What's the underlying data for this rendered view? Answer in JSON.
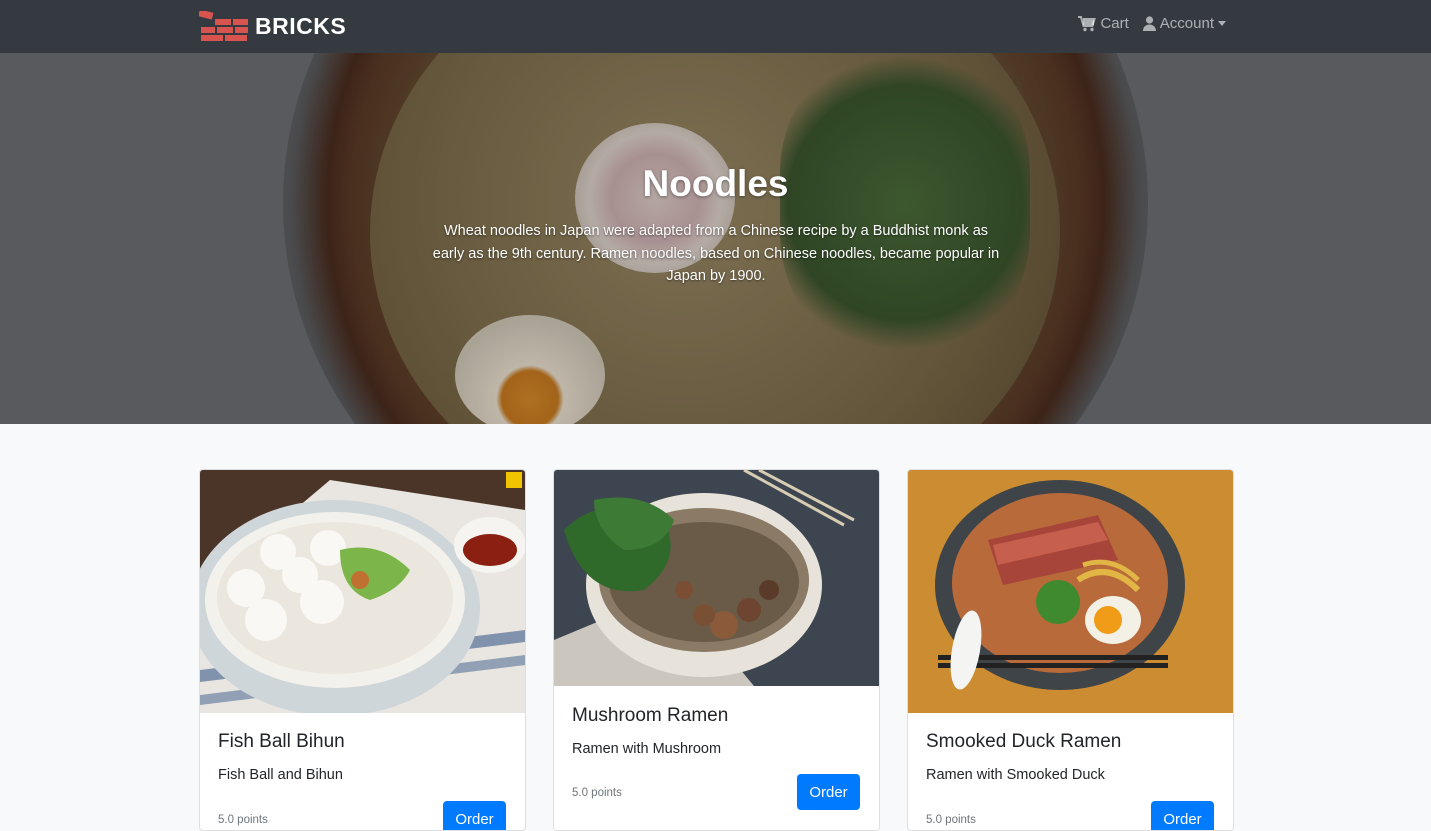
{
  "brand": {
    "name": "BRICKS",
    "logo_color": "#d9534f"
  },
  "nav": {
    "cart_label": "Cart",
    "account_label": "Account"
  },
  "hero": {
    "title": "Noodles",
    "description": "Wheat noodles in Japan were adapted from a Chinese recipe by a Buddhist monk as early as the 9th century. Ramen noodles, based on Chinese noodles, became popular in Japan by 1900."
  },
  "products": [
    {
      "name": "Fish Ball Bihun",
      "description": "Fish Ball and Bihun",
      "points": "5.0 points",
      "order_label": "Order"
    },
    {
      "name": "Mushroom Ramen",
      "description": "Ramen with Mushroom",
      "points": "5.0 points",
      "order_label": "Order"
    },
    {
      "name": "Smooked Duck Ramen",
      "description": "Ramen with Smooked Duck",
      "points": "5.0 points",
      "order_label": "Order"
    }
  ],
  "colors": {
    "navbar": "#343a40",
    "primary": "#007bff",
    "page_bg": "#f8f9fa"
  }
}
